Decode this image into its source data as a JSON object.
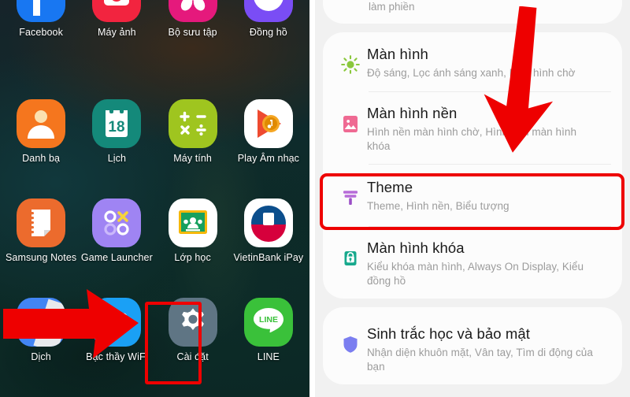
{
  "left_panel": {
    "name": "android-home-screen",
    "apps": [
      {
        "label": "Facebook",
        "icon": "facebook-icon"
      },
      {
        "label": "Máy ảnh",
        "icon": "camera-icon"
      },
      {
        "label": "Bộ sưu tập",
        "icon": "gallery-icon"
      },
      {
        "label": "Đồng hồ",
        "icon": "clock-icon"
      },
      {
        "label": "Danh bạ",
        "icon": "contacts-icon"
      },
      {
        "label": "Lịch",
        "icon": "calendar-icon"
      },
      {
        "label": "Máy tính",
        "icon": "calculator-icon"
      },
      {
        "label": "Play Âm nhạc",
        "icon": "play-music-icon"
      },
      {
        "label": "Samsung Notes",
        "icon": "samsung-notes-icon"
      },
      {
        "label": "Game Launcher",
        "icon": "game-launcher-icon"
      },
      {
        "label": "Lớp học",
        "icon": "google-classroom-icon"
      },
      {
        "label": "VietinBank iPay",
        "icon": "vietinbank-icon"
      },
      {
        "label": "Dịch",
        "icon": "translate-icon"
      },
      {
        "label": "Bậc thầy WiFi",
        "icon": "wifi-master-icon"
      },
      {
        "label": "Cài đặt",
        "icon": "settings-gear-icon"
      },
      {
        "label": "LINE",
        "icon": "line-icon"
      }
    ],
    "calendar_day": "18",
    "line_text": "LINE"
  },
  "right_panel": {
    "name": "samsung-settings-list",
    "partial_row_text": "làm phiền",
    "groups": [
      {
        "rows": [
          {
            "title": "Màn hình",
            "subtitle": "Độ sáng, Lọc ánh sáng xanh, Màn hình chờ",
            "icon": "brightness-sun-icon",
            "icon_color": "#8ac83c"
          },
          {
            "title": "Màn hình nền",
            "subtitle": "Hình nền màn hình chờ, Hình nền màn hình khóa",
            "icon": "wallpaper-image-icon",
            "icon_color": "#ef6a93"
          },
          {
            "title": "Theme",
            "subtitle": "Theme, Hình nền, Biểu tượng",
            "icon": "paint-roller-icon",
            "icon_color": "#b76cd8",
            "highlighted": true
          },
          {
            "title": "Màn hình khóa",
            "subtitle": "Kiểu khóa màn hình, Always On Display, Kiểu đồng hồ",
            "icon": "lock-icon",
            "icon_color": "#17a98d"
          }
        ]
      },
      {
        "rows": [
          {
            "title": "Sinh trắc học và bảo mật",
            "subtitle": "Nhận diện khuôn mặt, Vân tay, Tìm di động của bạn",
            "icon": "shield-icon",
            "icon_color": "#7b7ef0"
          }
        ]
      }
    ]
  },
  "annotations": {
    "arrow_right_label": "red-arrow-pointing-to-settings",
    "arrow_down_label": "red-arrow-pointing-to-theme",
    "box_settings_label": "red-highlight-settings-app",
    "box_theme_label": "red-highlight-theme-row",
    "accent_color": "#ee0000"
  }
}
